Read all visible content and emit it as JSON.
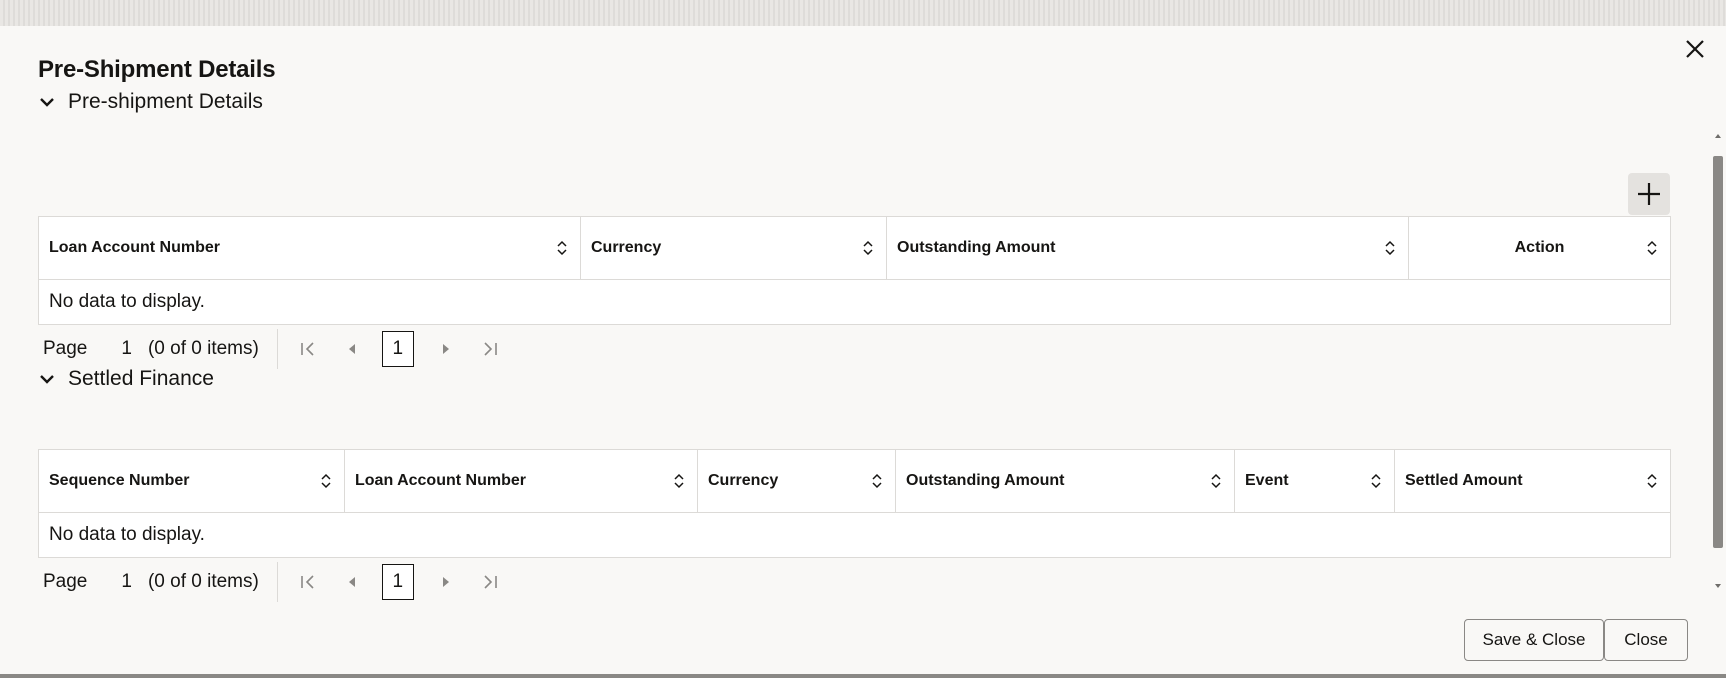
{
  "dialog": {
    "title": "Pre-Shipment Details"
  },
  "pre_shipment": {
    "section_label": "Pre-shipment Details",
    "columns": [
      "Loan Account Number",
      "Currency",
      "Outstanding Amount",
      "Action"
    ],
    "empty_text": "No data to display.",
    "pager": {
      "page_label": "Page",
      "page_number": "1",
      "item_count": "(0 of 0 items)",
      "current_page": "1"
    }
  },
  "settled_finance": {
    "section_label": "Settled Finance",
    "columns": [
      "Sequence Number",
      "Loan Account Number",
      "Currency",
      "Outstanding Amount",
      "Event",
      "Settled Amount"
    ],
    "empty_text": "No data to display.",
    "pager": {
      "page_label": "Page",
      "page_number": "1",
      "item_count": "(0 of 0 items)",
      "current_page": "1"
    }
  },
  "footer": {
    "save_close_label": "Save & Close",
    "close_label": "Close"
  },
  "icons": {
    "close": "close-icon",
    "chevron": "chevron-down-icon",
    "add": "plus-icon",
    "sort": "sort-icon",
    "first": "first-page-icon",
    "prev": "previous-page-icon",
    "next": "next-page-icon",
    "last": "last-page-icon"
  },
  "colors": {
    "text": "#161513",
    "surface": "#f9f8f6",
    "border": "#dcdad7"
  }
}
